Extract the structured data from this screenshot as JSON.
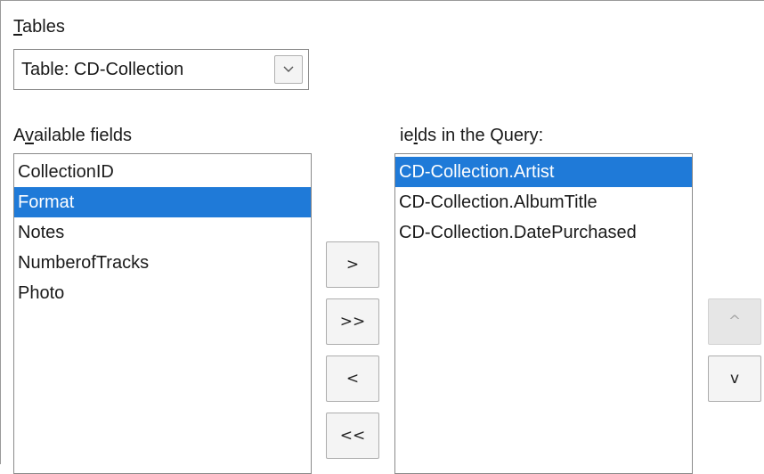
{
  "tables": {
    "label_accel": "T",
    "label_rest": "ables",
    "selected_table": "Table: CD-Collection"
  },
  "available_fields": {
    "label_prefix": "A",
    "label_accel": "v",
    "label_rest": "ailable fields",
    "items": [
      "CollectionID",
      "Format",
      "Notes",
      "NumberofTracks",
      "Photo"
    ],
    "selected_index": 1
  },
  "query_fields": {
    "label_visible_start": "ie",
    "label_accel": "l",
    "label_rest": "ds in the Query:",
    "items": [
      "CD-Collection.Artist",
      "CD-Collection.AlbumTitle",
      "CD-Collection.DatePurchased"
    ],
    "selected_index": 0
  },
  "transfer_buttons": {
    "add_selected": ">",
    "add_all": ">>",
    "remove_selected": "<",
    "remove_all": "<<"
  },
  "order_buttons": {
    "move_up": "^",
    "move_down": "v"
  }
}
